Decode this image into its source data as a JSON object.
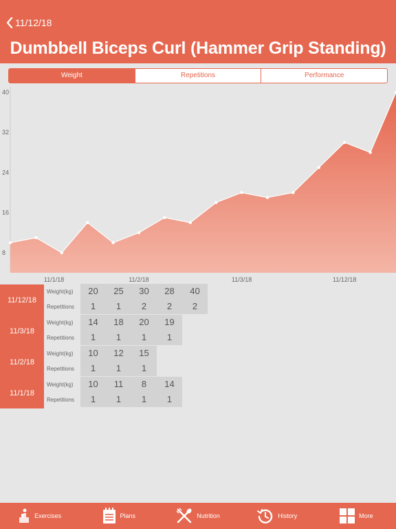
{
  "header": {
    "back_label": "11/12/18",
    "title": "Dumbbell Biceps Curl (Hammer Grip Standing)"
  },
  "tabs": [
    {
      "label": "Weight",
      "active": true
    },
    {
      "label": "Repetitions",
      "active": false
    },
    {
      "label": "Performance",
      "active": false
    }
  ],
  "chart_data": {
    "type": "area",
    "y_ticks": [
      8,
      16,
      24,
      32,
      40
    ],
    "x_labels": [
      "11/1/18",
      "11/2/18",
      "11/3/18",
      "11/12/18"
    ],
    "ylim": [
      4,
      40
    ],
    "values": [
      10,
      11,
      8,
      14,
      10,
      12,
      15,
      14,
      18,
      20,
      19,
      20,
      25,
      30,
      28,
      40
    ],
    "fill_color": "#e8735a",
    "line_color": "#ffffff"
  },
  "history": [
    {
      "date": "11/12/18",
      "weight_label": "Weight(kg)",
      "reps_label": "Repetitions",
      "weights": [
        "20",
        "25",
        "30",
        "28",
        "40"
      ],
      "reps": [
        "1",
        "1",
        "2",
        "2",
        "2"
      ]
    },
    {
      "date": "11/3/18",
      "weight_label": "Weight(kg)",
      "reps_label": "Repetitions",
      "weights": [
        "14",
        "18",
        "20",
        "19"
      ],
      "reps": [
        "1",
        "1",
        "1",
        "1"
      ]
    },
    {
      "date": "11/2/18",
      "weight_label": "Weight(kg)",
      "reps_label": "Repetitions",
      "weights": [
        "10",
        "12",
        "15"
      ],
      "reps": [
        "1",
        "1",
        "1"
      ]
    },
    {
      "date": "11/1/18",
      "weight_label": "Weight(kg)",
      "reps_label": "Repetitions",
      "weights": [
        "10",
        "11",
        "8",
        "14"
      ],
      "reps": [
        "1",
        "1",
        "1",
        "1"
      ]
    }
  ],
  "tabbar": [
    {
      "label": "Exercises",
      "icon": "exercises-icon"
    },
    {
      "label": "Plans",
      "icon": "plans-icon"
    },
    {
      "label": "Nutrition",
      "icon": "nutrition-icon"
    },
    {
      "label": "History",
      "icon": "history-icon"
    },
    {
      "label": "More",
      "icon": "more-icon"
    }
  ],
  "colors": {
    "accent": "#e5674f",
    "background": "#e6e6e6",
    "cell": "#d3d3d3"
  }
}
